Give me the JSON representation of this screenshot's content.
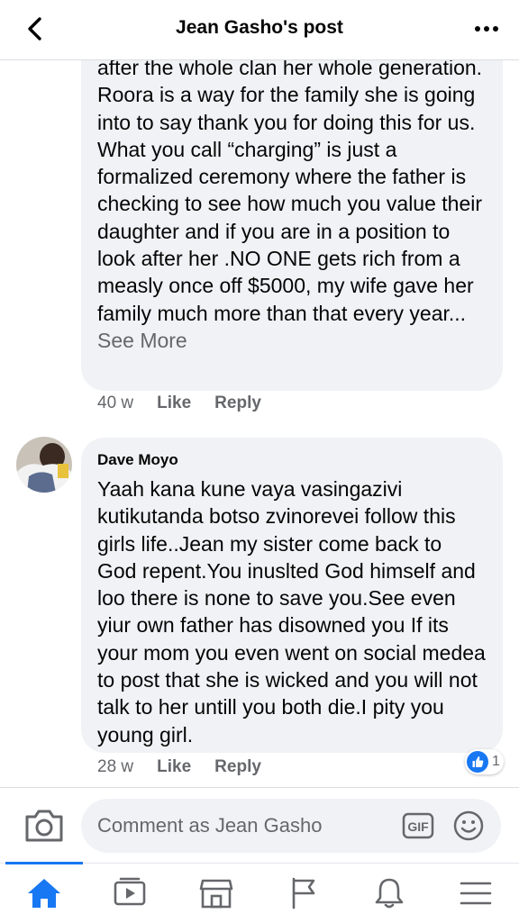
{
  "header": {
    "title": "Jean Gasho's post",
    "back_icon": "chevron-left-icon",
    "more_icon": "more-horizontal-icon"
  },
  "comment1": {
    "text": "after the whole clan her whole generation. Roora is a way for the family she is going into to say thank you for doing this for us. What you call “charging” is just a formalized ceremony where the father is checking to see how much you value their daughter and if you are in a position to look after her .NO ONE gets rich from a measly once off $5000, my wife gave her family much more than that every year...",
    "see_more": "See More",
    "time": "40 w",
    "like_label": "Like",
    "reply_label": "Reply"
  },
  "comment2": {
    "author": "Dave Moyo",
    "text": "Yaah kana kune vaya vasingazivi kutikutanda botso zvinorevei follow this girls life..Jean my sister come back to God repent.You inuslted God himself and loo there is none to save you.See even yiur own father has disowned you If its your mom you even went on social medea to post that she is wicked and you will not talk to her untill you both die.I pity you young girl.",
    "time": "28 w",
    "like_label": "Like",
    "reply_label": "Reply",
    "reaction_icon": "like-thumb-icon",
    "reaction_count": "1"
  },
  "composer": {
    "placeholder": "Comment as Jean Gasho",
    "camera_icon": "camera-icon",
    "gif_label": "GIF",
    "emoji_icon": "smiley-icon"
  },
  "tabbar": {
    "active_color": "#1877f2",
    "tabs": [
      "home-icon",
      "video-icon",
      "marketplace-icon",
      "pages-flag-icon",
      "notifications-bell-icon",
      "menu-icon"
    ]
  }
}
